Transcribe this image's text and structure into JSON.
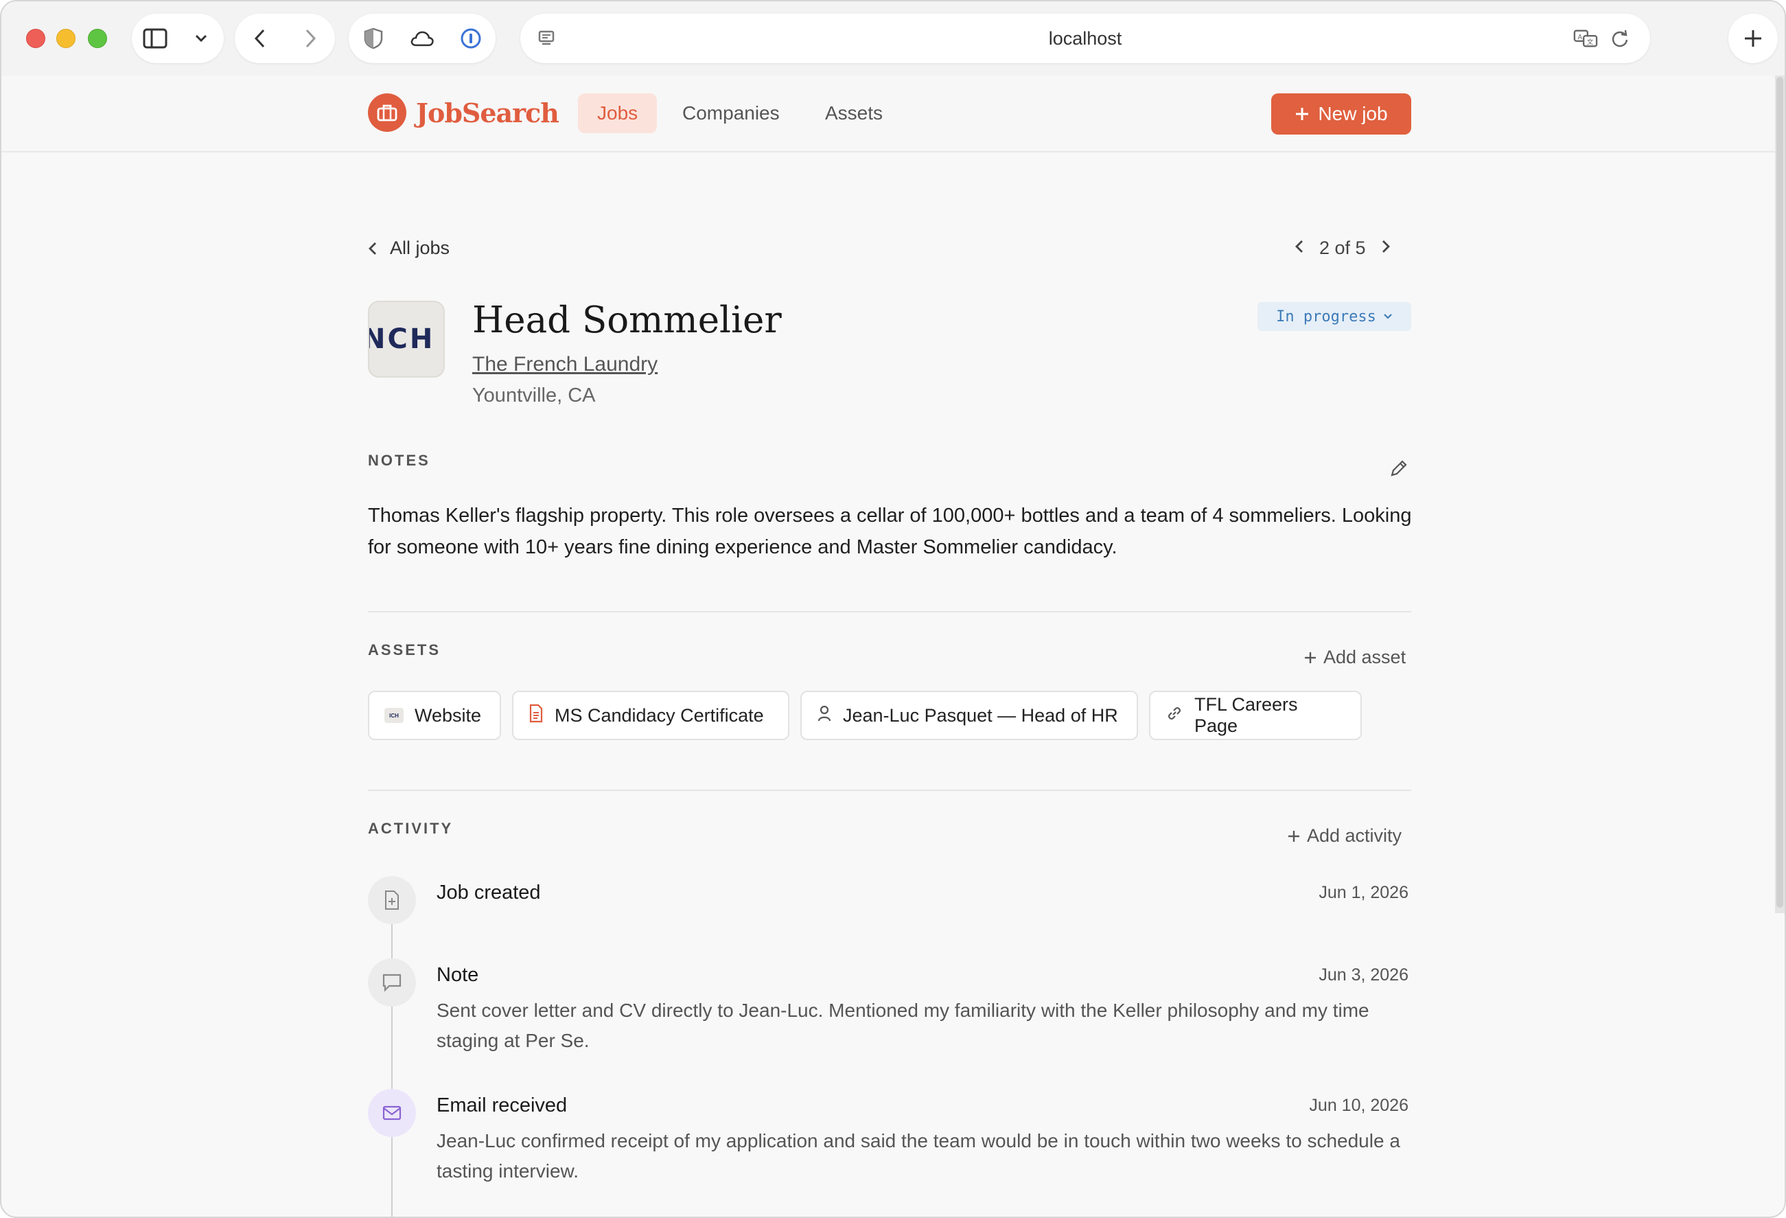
{
  "browser": {
    "url": "localhost"
  },
  "app": {
    "brand": "JobSearch",
    "nav": {
      "jobs": "Jobs",
      "companies": "Companies",
      "assets": "Assets"
    },
    "new_job_label": "New job",
    "accent_color": "#e05d3f"
  },
  "job": {
    "back_label": "All jobs",
    "pager": "2 of 5",
    "logo_text": "NCH",
    "title": "Head Sommelier",
    "company": "The French Laundry",
    "location": "Yountville, CA",
    "status": "In progress"
  },
  "notes": {
    "label": "NOTES",
    "text": "Thomas Keller's flagship property. This role oversees a cellar of 100,000+ bottles and a team of 4 sommeliers. Looking for someone with 10+ years fine dining experience and Master Sommelier candidacy."
  },
  "assets": {
    "label": "ASSETS",
    "add_label": "Add asset",
    "items": [
      {
        "label": "Website",
        "icon": "company-logo-icon"
      },
      {
        "label": "MS Candidacy Certificate",
        "icon": "document-icon"
      },
      {
        "label": "Jean-Luc Pasquet — Head of HR",
        "icon": "person-icon"
      },
      {
        "label": "TFL Careers Page",
        "icon": "link-icon"
      }
    ]
  },
  "activity": {
    "label": "ACTIVITY",
    "add_label": "Add activity",
    "items": [
      {
        "title": "Job created",
        "date": "Jun 1, 2026",
        "body": "",
        "icon": "file-plus-icon"
      },
      {
        "title": "Note",
        "date": "Jun 3, 2026",
        "body": "Sent cover letter and CV directly to Jean-Luc. Mentioned my familiarity with the Keller philosophy and my time staging at Per Se.",
        "icon": "chat-bubble-icon"
      },
      {
        "title": "Email received",
        "date": "Jun 10, 2026",
        "body": "Jean-Luc confirmed receipt of my application and said the team would be in touch within two weeks to schedule a tasting interview.",
        "icon": "mail-icon"
      }
    ]
  }
}
